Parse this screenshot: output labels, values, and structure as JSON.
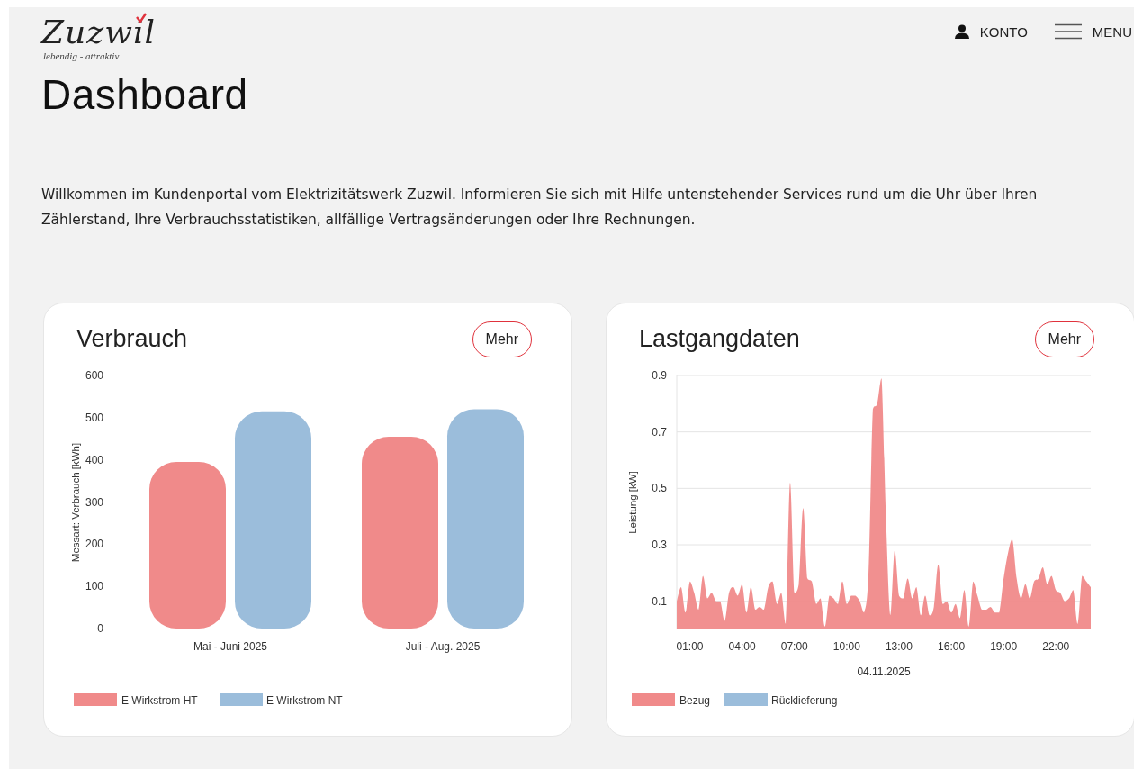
{
  "header": {
    "logo": {
      "name": "Zuzwil",
      "tagline": "lebendig - attraktiv"
    },
    "account": "KONTO",
    "menu": "MENU"
  },
  "page_title": "Dashboard",
  "intro": "Willkommen im Kundenportal vom Elektrizitätswerk Zuzwil. Informieren Sie sich mit Hilfe untenstehender Services rund um die Uhr über Ihren Zählerstand, Ihre Verbrauchsstatistiken, allfällige Vertragsänderungen oder Ihre Rechnungen.",
  "cards": [
    {
      "title": "Verbrauch",
      "button": "Mehr",
      "chart_data": {
        "type": "bar",
        "ylabel": "Messart: Verbrauch [kWh]",
        "categories": [
          "Mai - Juni 2025",
          "Juli - Aug. 2025"
        ],
        "ylim": [
          0,
          600
        ],
        "yticks": [
          0,
          100,
          200,
          300,
          400,
          500,
          600
        ],
        "series": [
          {
            "name": "E Wirkstrom HT",
            "color": "#f08a8a",
            "values": [
              395,
              455
            ]
          },
          {
            "name": "E Wirkstrom NT",
            "color": "#9bbddb",
            "values": [
              515,
              520
            ]
          }
        ],
        "legend": "bottom"
      }
    },
    {
      "title": "Lastgangdaten",
      "button": "Mehr",
      "chart_data": {
        "type": "area",
        "xlabel": "04.11.2025",
        "ylabel": "Leistung [kW]",
        "ylim": [
          0,
          0.9
        ],
        "yticks": [
          0.1,
          0.3,
          0.5,
          0.7,
          0.9
        ],
        "xlim": [
          0.25,
          24
        ],
        "xticks": [
          {
            "value": 1,
            "label": "01:00"
          },
          {
            "value": 4,
            "label": "04:00"
          },
          {
            "value": 7,
            "label": "07:00"
          },
          {
            "value": 10,
            "label": "10:00"
          },
          {
            "value": 13,
            "label": "13:00"
          },
          {
            "value": 16,
            "label": "16:00"
          },
          {
            "value": 19,
            "label": "19:00"
          },
          {
            "value": 22,
            "label": "22:00"
          }
        ],
        "x": [
          0.25,
          0.5,
          0.75,
          1,
          1.25,
          1.5,
          1.75,
          2,
          2.25,
          2.5,
          2.75,
          3,
          3.25,
          3.5,
          3.75,
          4,
          4.25,
          4.5,
          4.75,
          5,
          5.25,
          5.5,
          5.75,
          6,
          6.25,
          6.5,
          6.75,
          7,
          7.25,
          7.5,
          7.75,
          8,
          8.25,
          8.5,
          8.75,
          9,
          9.25,
          9.5,
          9.75,
          10,
          10.25,
          10.5,
          10.75,
          11,
          11.25,
          11.5,
          11.75,
          12,
          12.25,
          12.5,
          12.75,
          13,
          13.25,
          13.5,
          13.75,
          14,
          14.25,
          14.5,
          14.75,
          15,
          15.25,
          15.5,
          15.75,
          16,
          16.25,
          16.5,
          16.75,
          17,
          17.25,
          17.5,
          17.75,
          18,
          18.25,
          18.5,
          18.75,
          19,
          19.25,
          19.5,
          19.75,
          20,
          20.25,
          20.5,
          20.75,
          21,
          21.25,
          21.5,
          21.75,
          22,
          22.25,
          22.5,
          22.75,
          23,
          23.25,
          23.5,
          23.75,
          24
        ],
        "series": [
          {
            "name": "Bezug",
            "color": "#f08a8a",
            "values": [
              0.1,
              0.15,
              0.06,
              0.17,
              0.13,
              0.07,
              0.19,
              0.11,
              0.13,
              0.1,
              0.1,
              0.03,
              0.13,
              0.15,
              0.12,
              0.16,
              0.06,
              0.15,
              0.07,
              0.08,
              0.07,
              0.15,
              0.17,
              0.09,
              0.13,
              0.02,
              0.52,
              0.13,
              0.16,
              0.43,
              0.18,
              0.17,
              0.09,
              0.11,
              0.01,
              0.12,
              0.11,
              0.09,
              0.17,
              0.09,
              0.12,
              0.12,
              0.1,
              0.06,
              0.2,
              0.78,
              0.8,
              0.89,
              0.4,
              0.05,
              0.28,
              0.12,
              0.11,
              0.18,
              0.11,
              0.15,
              0.05,
              0.12,
              0.05,
              0.08,
              0.23,
              0.09,
              0.1,
              0.06,
              0.09,
              0.04,
              0.14,
              0.01,
              0.17,
              0.12,
              0.07,
              0.07,
              0.08,
              0.06,
              0.06,
              0.18,
              0.27,
              0.32,
              0.18,
              0.11,
              0.16,
              0.11,
              0.17,
              0.18,
              0.22,
              0.16,
              0.19,
              0.14,
              0.13,
              0.1,
              0.11,
              0.14,
              0.02,
              0.19,
              0.17,
              0.15
            ]
          },
          {
            "name": "Rücklieferung",
            "color": "#9bbddb",
            "values": [
              null,
              null,
              null,
              null,
              null,
              null,
              null,
              null,
              null,
              null,
              null,
              null,
              null,
              null,
              null,
              null,
              null,
              null,
              null,
              null,
              null,
              null,
              null,
              null,
              null,
              null,
              null,
              null,
              null,
              null,
              null,
              null,
              null,
              null,
              null,
              null,
              null,
              null,
              null,
              null,
              null,
              null,
              null,
              null,
              null,
              null,
              null,
              null,
              null,
              null,
              null,
              null,
              null,
              null,
              null,
              null,
              null,
              null,
              null,
              null,
              null,
              null,
              null,
              null,
              null,
              null,
              null,
              null,
              null,
              null,
              null,
              null,
              null,
              null,
              null,
              null,
              null,
              null,
              null,
              null,
              null,
              null,
              null,
              null,
              null,
              null,
              null,
              null,
              null,
              null,
              null,
              null,
              null,
              null,
              null,
              null
            ]
          }
        ],
        "legend": "bottom",
        "grid": true
      }
    }
  ]
}
